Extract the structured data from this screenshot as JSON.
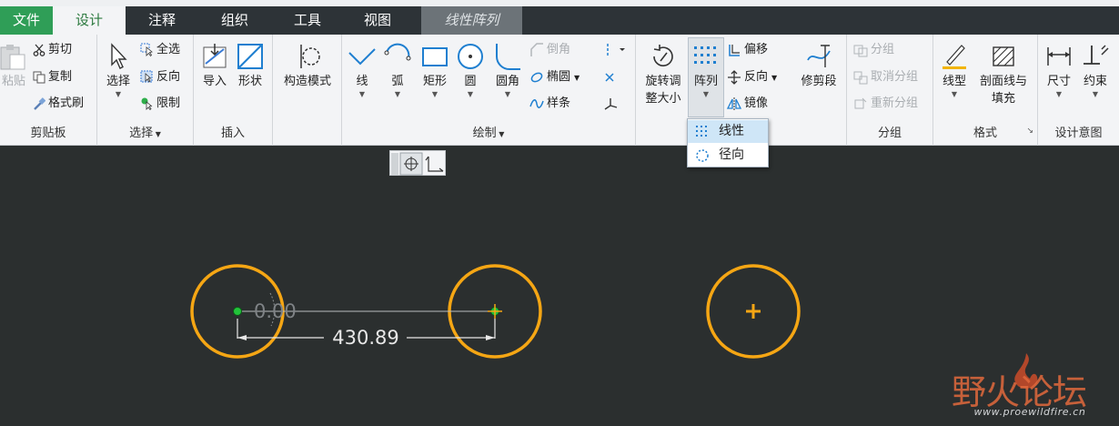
{
  "tabs": [
    "文件",
    "设计",
    "注释",
    "组织",
    "工具",
    "视图",
    "线性阵列"
  ],
  "clipboard": {
    "paste": "粘贴",
    "cut": "剪切",
    "copy": "复制",
    "format_painter": "格式刷",
    "label": "剪贴板"
  },
  "select": {
    "select": "选择",
    "select_all": "全选",
    "invert": "反向",
    "limit": "限制",
    "label": "选择"
  },
  "insert": {
    "import": "导入",
    "shape": "形状",
    "label": "插入"
  },
  "construct": {
    "mode": "构造模式"
  },
  "draw": {
    "line": "线",
    "arc": "弧",
    "rect": "矩形",
    "circle": "圆",
    "fillet": "圆角",
    "chamfer": "倒角",
    "ellipse": "椭圆",
    "spline": "样条",
    "label": "绘制"
  },
  "edit": {
    "rotate_l1": "旋转调",
    "rotate_l2": "整大小",
    "pattern": "阵列",
    "offset": "偏移",
    "reverse": "反向",
    "mirror": "镜像",
    "trim": "修剪段"
  },
  "grouping": {
    "group": "分组",
    "ungroup": "取消分组",
    "regroup": "重新分组",
    "label": "分组"
  },
  "format": {
    "linetype": "线型",
    "hatch_l1": "剖面线与",
    "hatch_l2": "填充",
    "label": "格式"
  },
  "intent": {
    "dimension": "尺寸",
    "constraint": "约束",
    "label": "设计意图"
  },
  "pattern_menu": {
    "linear": "线性",
    "radial": "径向"
  },
  "sketch": {
    "angle": "0.00",
    "distance": "430.89"
  },
  "watermark": {
    "brand_cn": "野火论坛",
    "url": "www.proewildfire.cn"
  },
  "colors": {
    "circle": "#f5a614",
    "dim": "#e8e8e8",
    "node": "#22c33a",
    "accent": "#2f9e57"
  }
}
